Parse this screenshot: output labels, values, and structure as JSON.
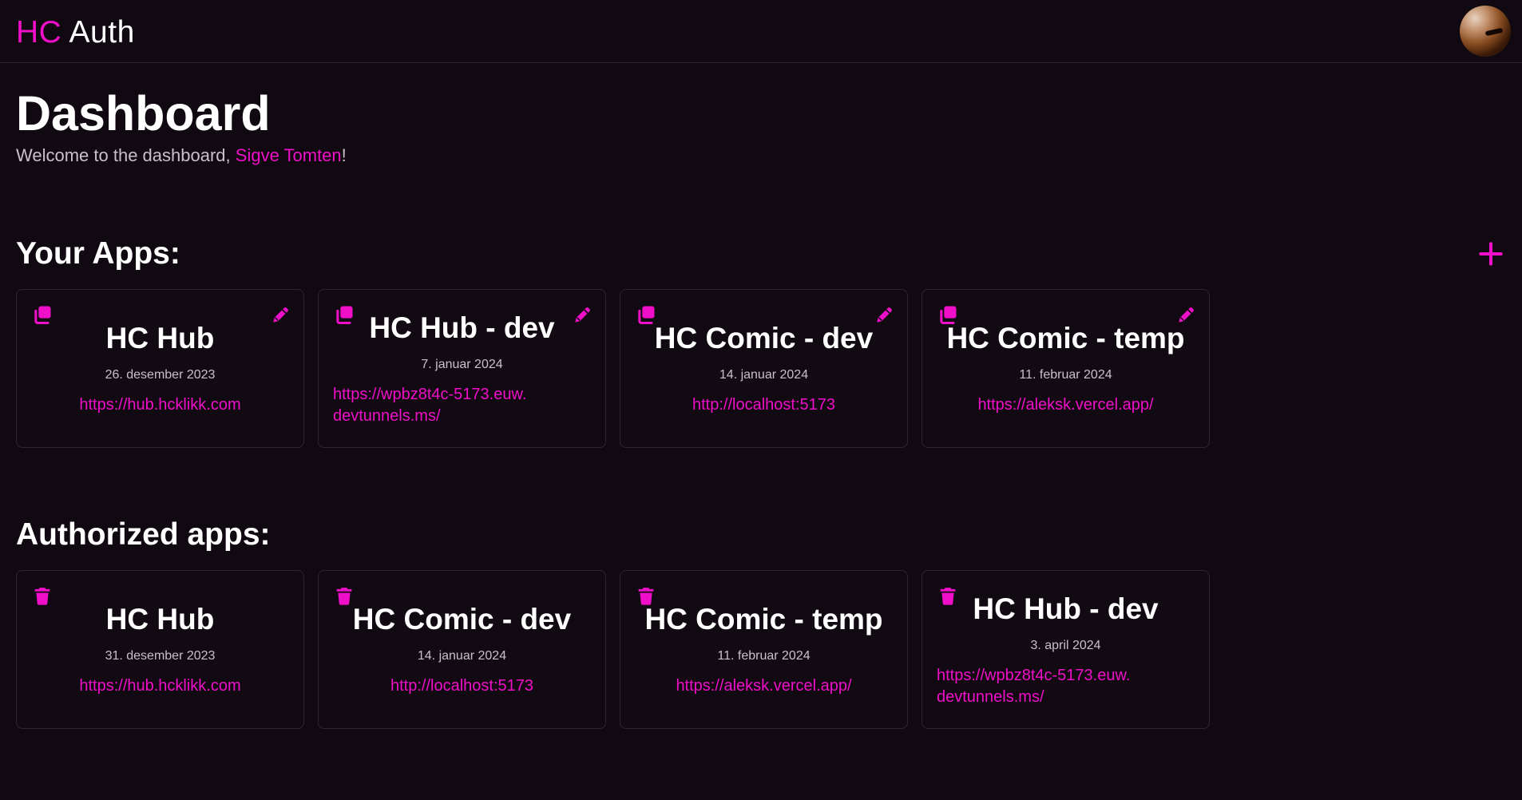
{
  "brand": {
    "accent": "HC",
    "rest": " Auth"
  },
  "colors": {
    "accent": "#f00fc8",
    "background": "#110911",
    "border": "#2e262e"
  },
  "page": {
    "title": "Dashboard",
    "welcome_prefix": "Welcome to the dashboard, ",
    "user_name": "Sigve Tomten",
    "welcome_suffix": "!"
  },
  "your_apps": {
    "heading": "Your Apps:",
    "add_icon": "plus-icon",
    "items": [
      {
        "name": "HC Hub",
        "date": "26. desember 2023",
        "url": "https://hub.hcklikk.com"
      },
      {
        "name": "HC Hub - dev",
        "date": "7. januar 2024",
        "url": "https://wpbz8t4c-5173.euw.devtunnels.ms/"
      },
      {
        "name": "HC Comic - dev",
        "date": "14. januar 2024",
        "url": "http://localhost:5173"
      },
      {
        "name": "HC Comic - temp",
        "date": "11. februar 2024",
        "url": "https://aleksk.vercel.app/"
      }
    ],
    "icons": {
      "copy": "copy-icon",
      "edit": "pencil-icon"
    }
  },
  "authorized_apps": {
    "heading": "Authorized apps:",
    "items": [
      {
        "name": "HC Hub",
        "date": "31. desember 2023",
        "url": "https://hub.hcklikk.com"
      },
      {
        "name": "HC Comic - dev",
        "date": "14. januar 2024",
        "url": "http://localhost:5173"
      },
      {
        "name": "HC Comic - temp",
        "date": "11. februar 2024",
        "url": "https://aleksk.vercel.app/"
      },
      {
        "name": "HC Hub - dev",
        "date": "3. april 2024",
        "url": "https://wpbz8t4c-5173.euw.devtunnels.ms/"
      }
    ],
    "icons": {
      "delete": "trash-icon"
    }
  }
}
